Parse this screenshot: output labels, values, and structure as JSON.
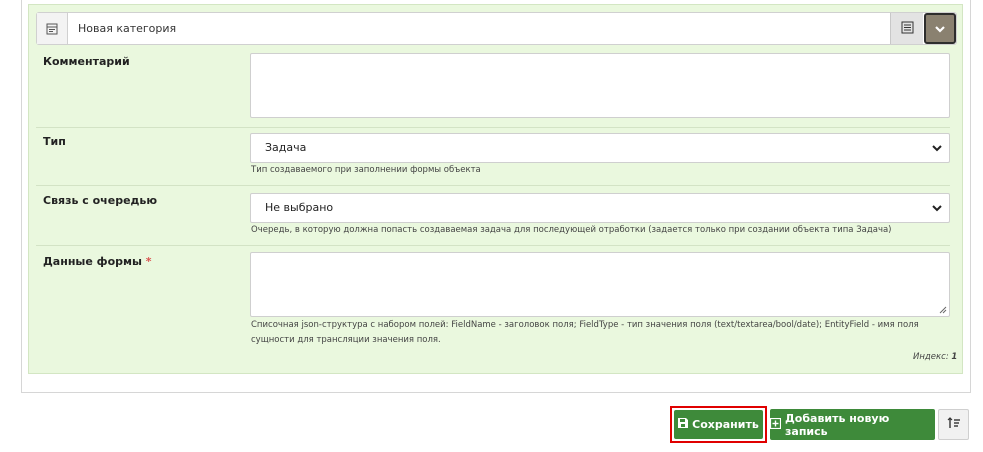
{
  "header": {
    "title": "Новая категория",
    "left_icon": "form-icon",
    "list_icon": "list-icon",
    "toggle_icon": "chevron-down-icon"
  },
  "fields": {
    "comment": {
      "label": "Комментарий",
      "value": ""
    },
    "type": {
      "label": "Тип",
      "value": "Задача",
      "hint": "Тип создаваемого при заполнении формы объекта"
    },
    "queue": {
      "label": "Связь с очередью",
      "value": "Не выбрано",
      "hint": "Очередь, в которую должна попасть создаваемая задача для последующей отработки (задается только при создании объекта типа Задача)"
    },
    "form_data": {
      "label": "Данные формы",
      "required_mark": "*",
      "value": "",
      "hint": "Списочная json-структура с набором полей: FieldName - заголовок поля; FieldType - тип значения поля (text/textarea/bool/date); EntityField - имя поля сущности для трансляции значения поля."
    }
  },
  "index": {
    "label": "Индекс:",
    "value": "1"
  },
  "actions": {
    "save_label": "Сохранить",
    "add_label": "Добавить новую запись",
    "save_icon": "floppy-disk-icon",
    "add_icon": "plus-square-icon",
    "sort_icon": "sort-icon"
  },
  "colors": {
    "panel_bg": "#eaf8de",
    "button_green": "#3e8a3a",
    "highlight_red": "#e00000"
  }
}
